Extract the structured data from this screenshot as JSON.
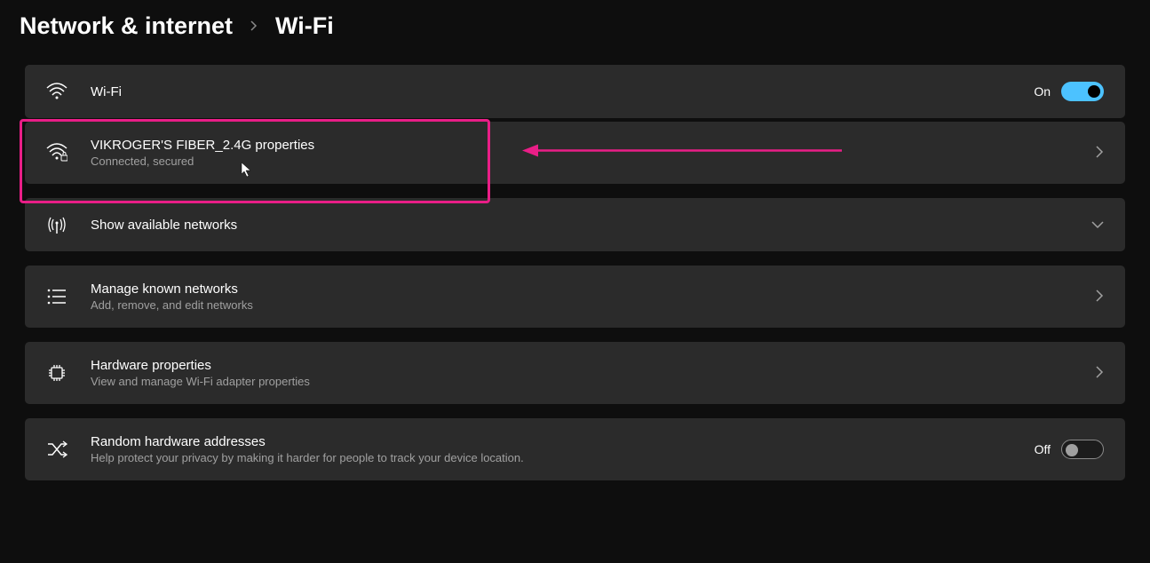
{
  "breadcrumb": {
    "parent": "Network & internet",
    "current": "Wi-Fi"
  },
  "cards": {
    "wifi": {
      "title": "Wi-Fi",
      "state_label": "On",
      "state": true
    },
    "properties": {
      "title": "VIKROGER'S FIBER_2.4G properties",
      "subtitle": "Connected, secured"
    },
    "available": {
      "title": "Show available networks"
    },
    "known": {
      "title": "Manage known networks",
      "subtitle": "Add, remove, and edit networks"
    },
    "hardware": {
      "title": "Hardware properties",
      "subtitle": "View and manage Wi-Fi adapter properties"
    },
    "random": {
      "title": "Random hardware addresses",
      "subtitle": "Help protect your privacy by making it harder for people to track your device location.",
      "state_label": "Off",
      "state": false
    }
  },
  "annotation": {
    "highlight_color": "#e91e87"
  }
}
